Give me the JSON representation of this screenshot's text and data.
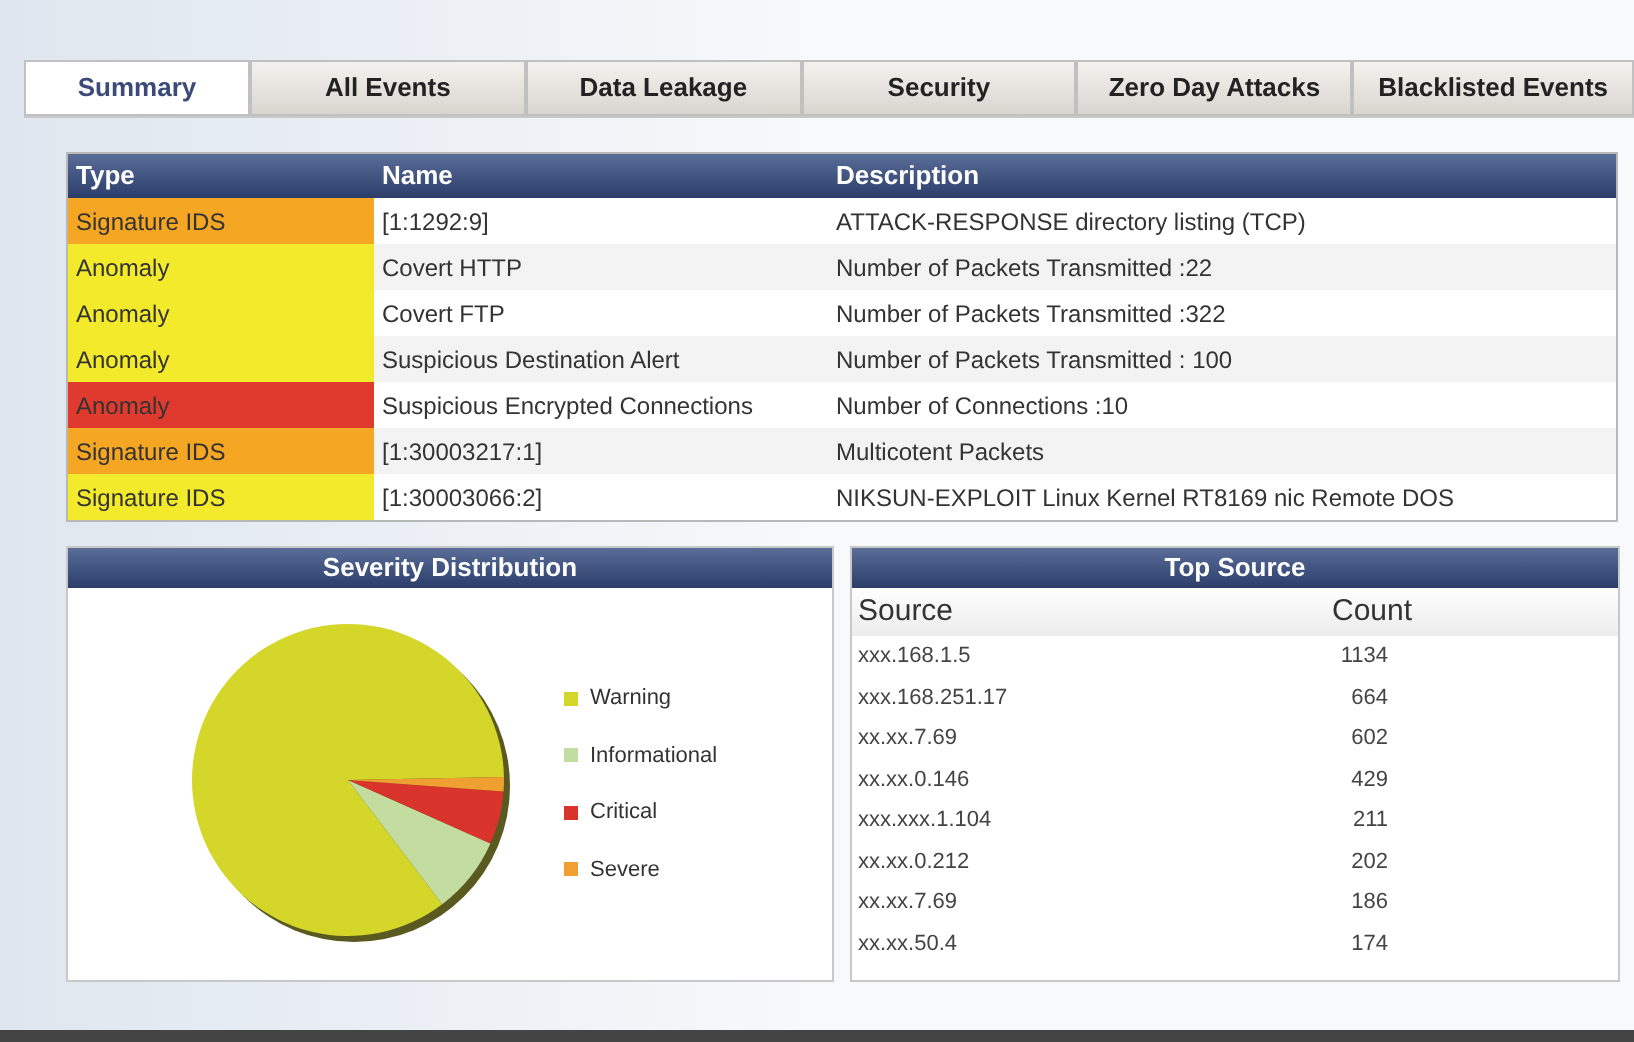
{
  "tabs": [
    {
      "label": "Summary",
      "selected": true
    },
    {
      "label": "All Events",
      "selected": false
    },
    {
      "label": "Data Leakage",
      "selected": false
    },
    {
      "label": "Security",
      "selected": false
    },
    {
      "label": "Zero Day Attacks",
      "selected": false
    },
    {
      "label": "Blacklisted Events",
      "selected": false
    }
  ],
  "events_table": {
    "columns": [
      "Type",
      "Name",
      "Description"
    ],
    "rows": [
      {
        "type": "Signature IDS",
        "color": "#f5a623",
        "name": "[1:1292:9]",
        "description": "ATTACK-RESPONSE directory listing (TCP)"
      },
      {
        "type": "Anomaly",
        "color": "#f2ea2a",
        "name": "Covert HTTP",
        "description": "Number of Packets Transmitted :22"
      },
      {
        "type": "Anomaly",
        "color": "#f2ea2a",
        "name": "Covert FTP",
        "description": "Number of Packets Transmitted :322"
      },
      {
        "type": "Anomaly",
        "color": "#f2ea2a",
        "name": "Suspicious Destination Alert",
        "description": "Number of Packets Transmitted : 100"
      },
      {
        "type": "Anomaly",
        "color": "#e03a2e",
        "name": "Suspicious Encrypted Connections",
        "description": "Number of Connections :10"
      },
      {
        "type": "Signature IDS",
        "color": "#f5a623",
        "name": "[1:30003217:1]",
        "description": "Multicotent Packets"
      },
      {
        "type": "Signature IDS",
        "color": "#f2ea2a",
        "name": "[1:30003066:2]",
        "description": "NIKSUN-EXPLOIT Linux Kernel RT8169 nic Remote DOS"
      }
    ]
  },
  "severity_panel": {
    "title": "Severity Distribution",
    "legend": [
      {
        "label": "Warning",
        "color": "#d4d62a"
      },
      {
        "label": "Informational",
        "color": "#c3dca0"
      },
      {
        "label": "Critical",
        "color": "#d9342b"
      },
      {
        "label": "Severe",
        "color": "#f0a030"
      }
    ]
  },
  "top_source_panel": {
    "title": "Top Source",
    "columns": [
      "Source",
      "Count"
    ],
    "rows": [
      {
        "source": "xxx.168.1.5",
        "count": "1134"
      },
      {
        "source": "xxx.168.251.17",
        "count": "664"
      },
      {
        "source": "xx.xx.7.69",
        "count": "602"
      },
      {
        "source": "xx.xx.0.146",
        "count": "429"
      },
      {
        "source": "xxx.xxx.1.104",
        "count": "211"
      },
      {
        "source": "xx.xx.0.212",
        "count": "202"
      },
      {
        "source": "xx.xx.7.69",
        "count": "186"
      },
      {
        "source": "xx.xx.50.4",
        "count": "174"
      }
    ]
  }
}
